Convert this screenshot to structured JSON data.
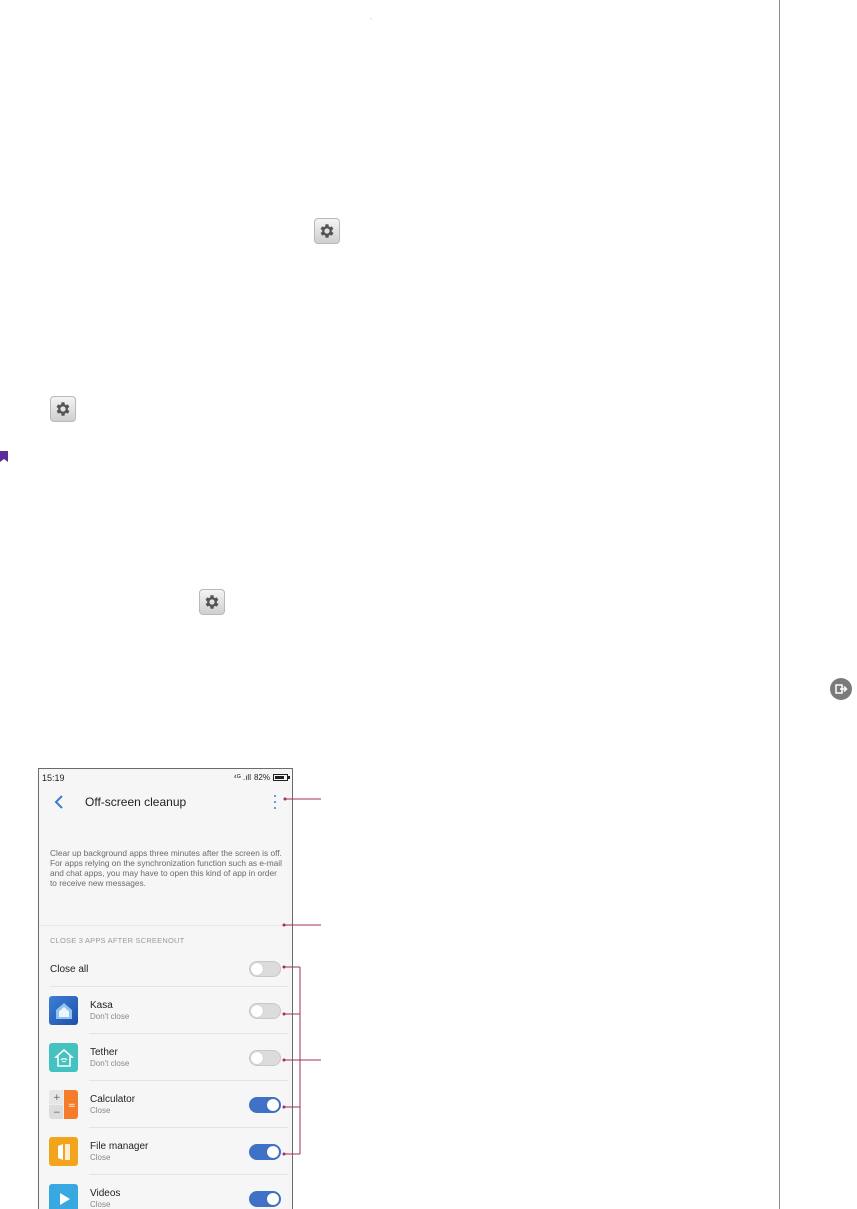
{
  "statusbar": {
    "time": "15:19",
    "signal": "⁴ᴳ .ıll",
    "battery": "82%"
  },
  "appbar": {
    "title": "Off-screen cleanup"
  },
  "description": "Clear up background apps three minutes after the screen is off. For apps relying on the synchronization function such as e-mail and chat apps, you may have to open this kind of app in order to receive new messages.",
  "section": {
    "header": "CLOSE 3 APPS AFTER SCREENOUT"
  },
  "close_all": {
    "label": "Close all",
    "enabled": false
  },
  "apps": [
    {
      "name": "Kasa",
      "status": "Don't close",
      "enabled": false,
      "icon": "kasa-icon",
      "color": "#2f64c0"
    },
    {
      "name": "Tether",
      "status": "Don't close",
      "enabled": false,
      "icon": "tether-icon",
      "color": "#45c2c0"
    },
    {
      "name": "Calculator",
      "status": "Close",
      "enabled": true,
      "icon": "calculator-icon",
      "color": "#f47c2a"
    },
    {
      "name": "File manager",
      "status": "Close",
      "enabled": true,
      "icon": "file-manager-icon",
      "color": "#f2a51c"
    },
    {
      "name": "Videos",
      "status": "Close",
      "enabled": true,
      "icon": "videos-icon",
      "color": "#37a8e0"
    }
  ],
  "colors": {
    "accent": "#3f72c6",
    "callout": "#a0305a"
  }
}
